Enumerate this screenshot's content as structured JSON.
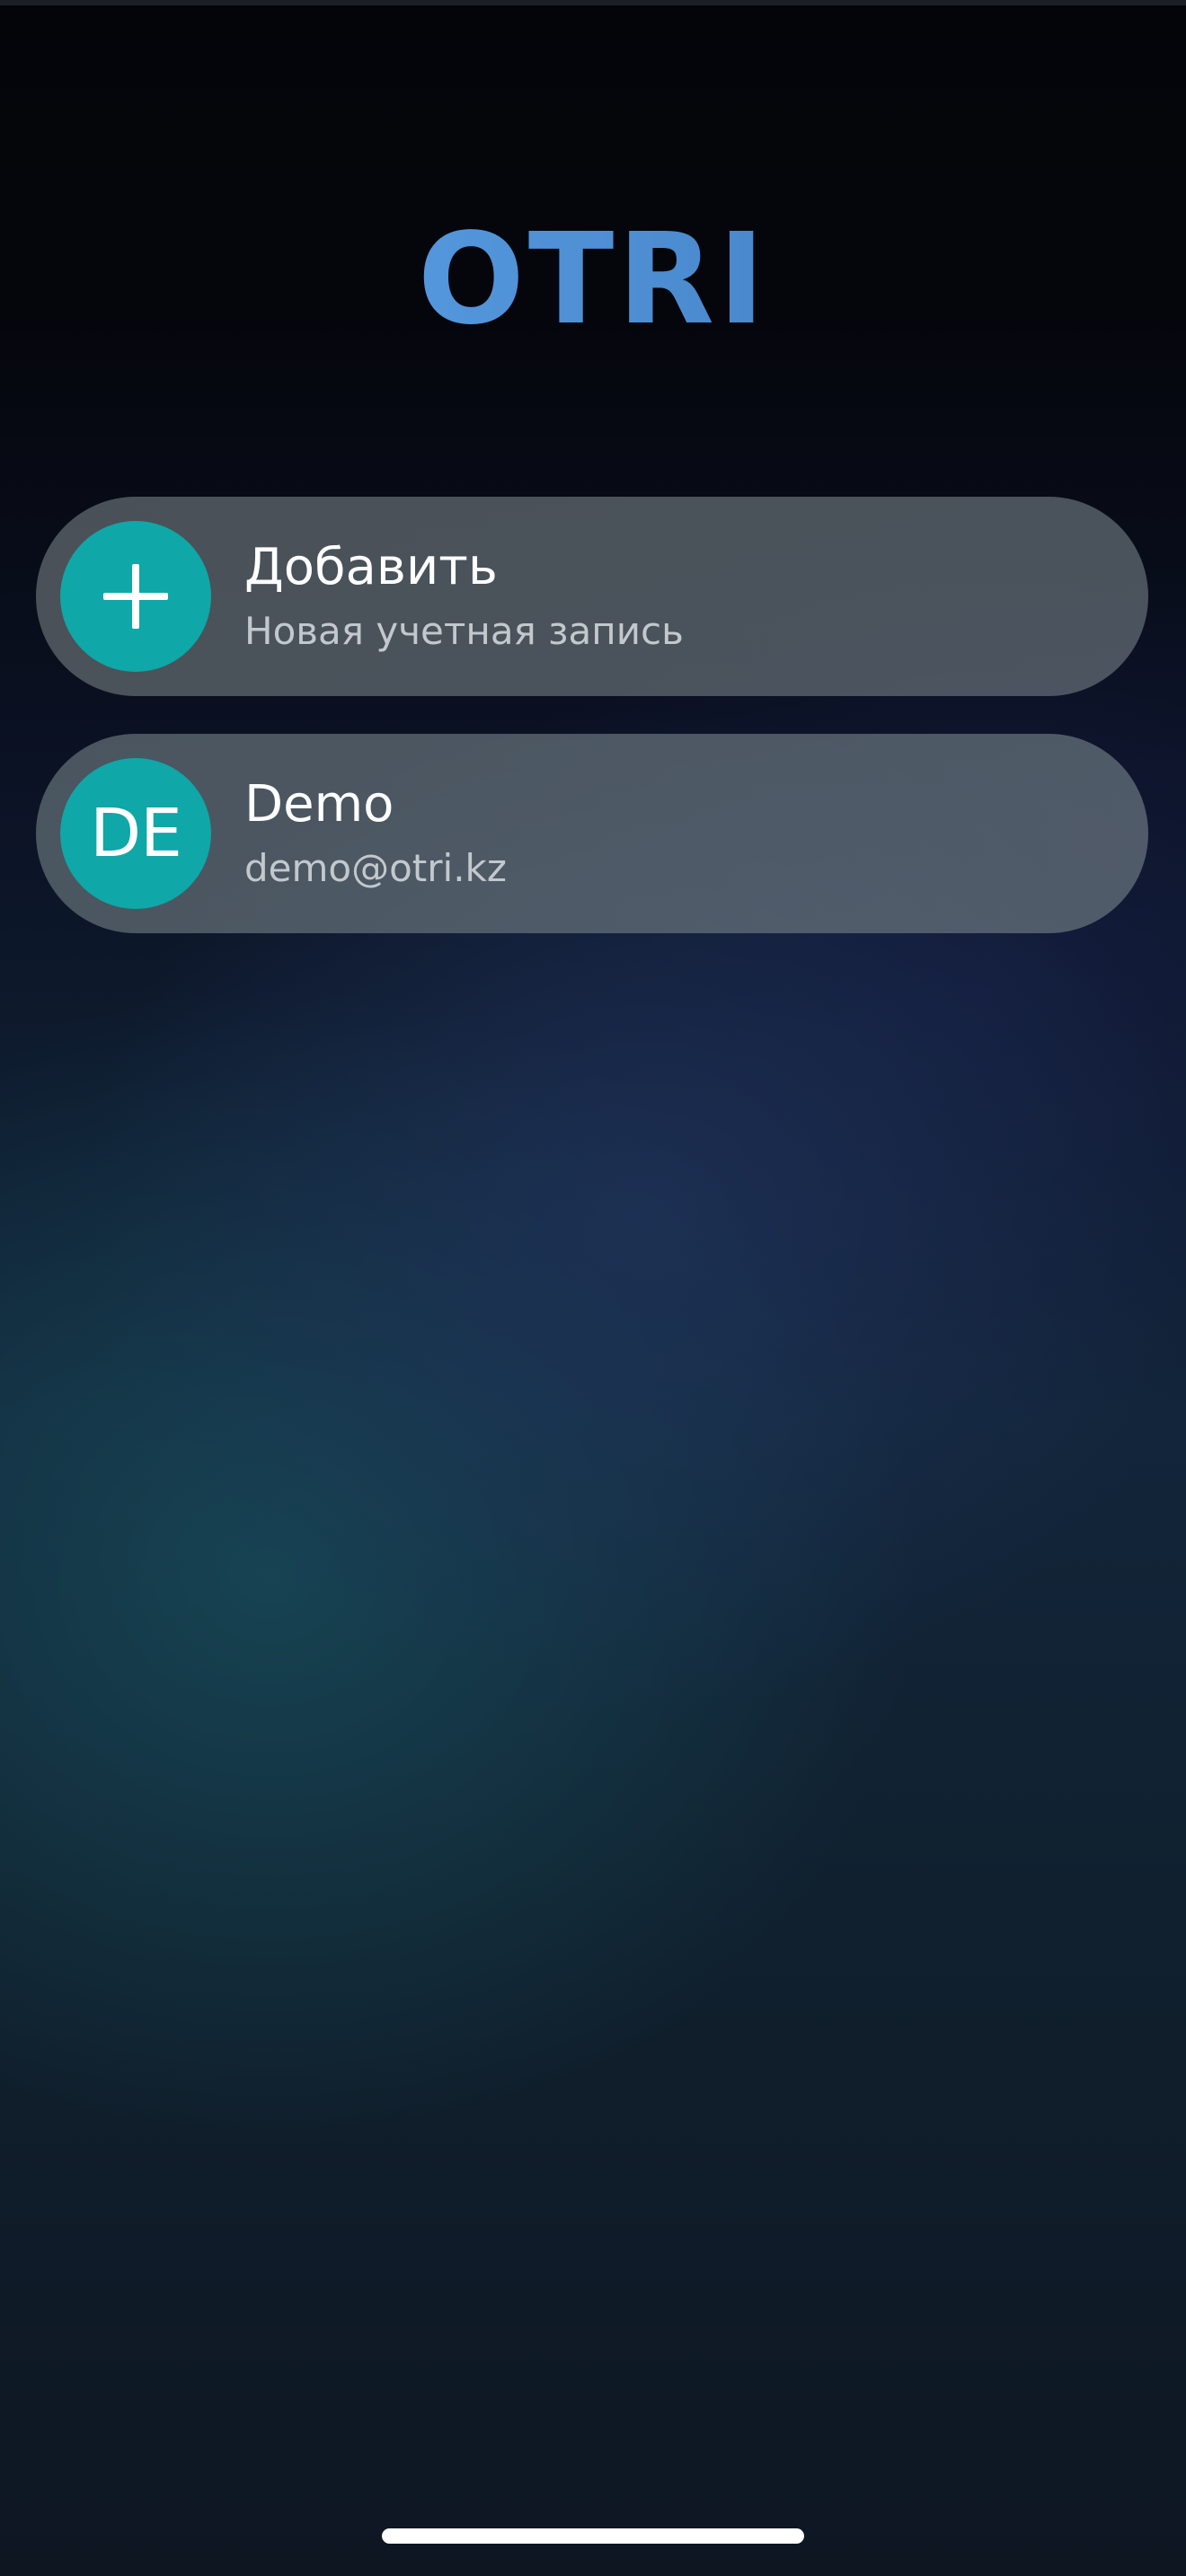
{
  "app": {
    "logo_text": "OTRI"
  },
  "accounts": {
    "add_item": {
      "title": "Добавить",
      "subtitle": "Новая учетная запись",
      "icon": "plus-icon"
    },
    "items": [
      {
        "initials": "DE",
        "name": "Demo",
        "email": "demo@otri.kz"
      }
    ]
  },
  "colors": {
    "logo": "#5aa4ea",
    "avatar": "#0fa7a7",
    "card": "#5c646a",
    "title_text": "#ffffff",
    "subtitle_text": "#c3c8cc"
  }
}
